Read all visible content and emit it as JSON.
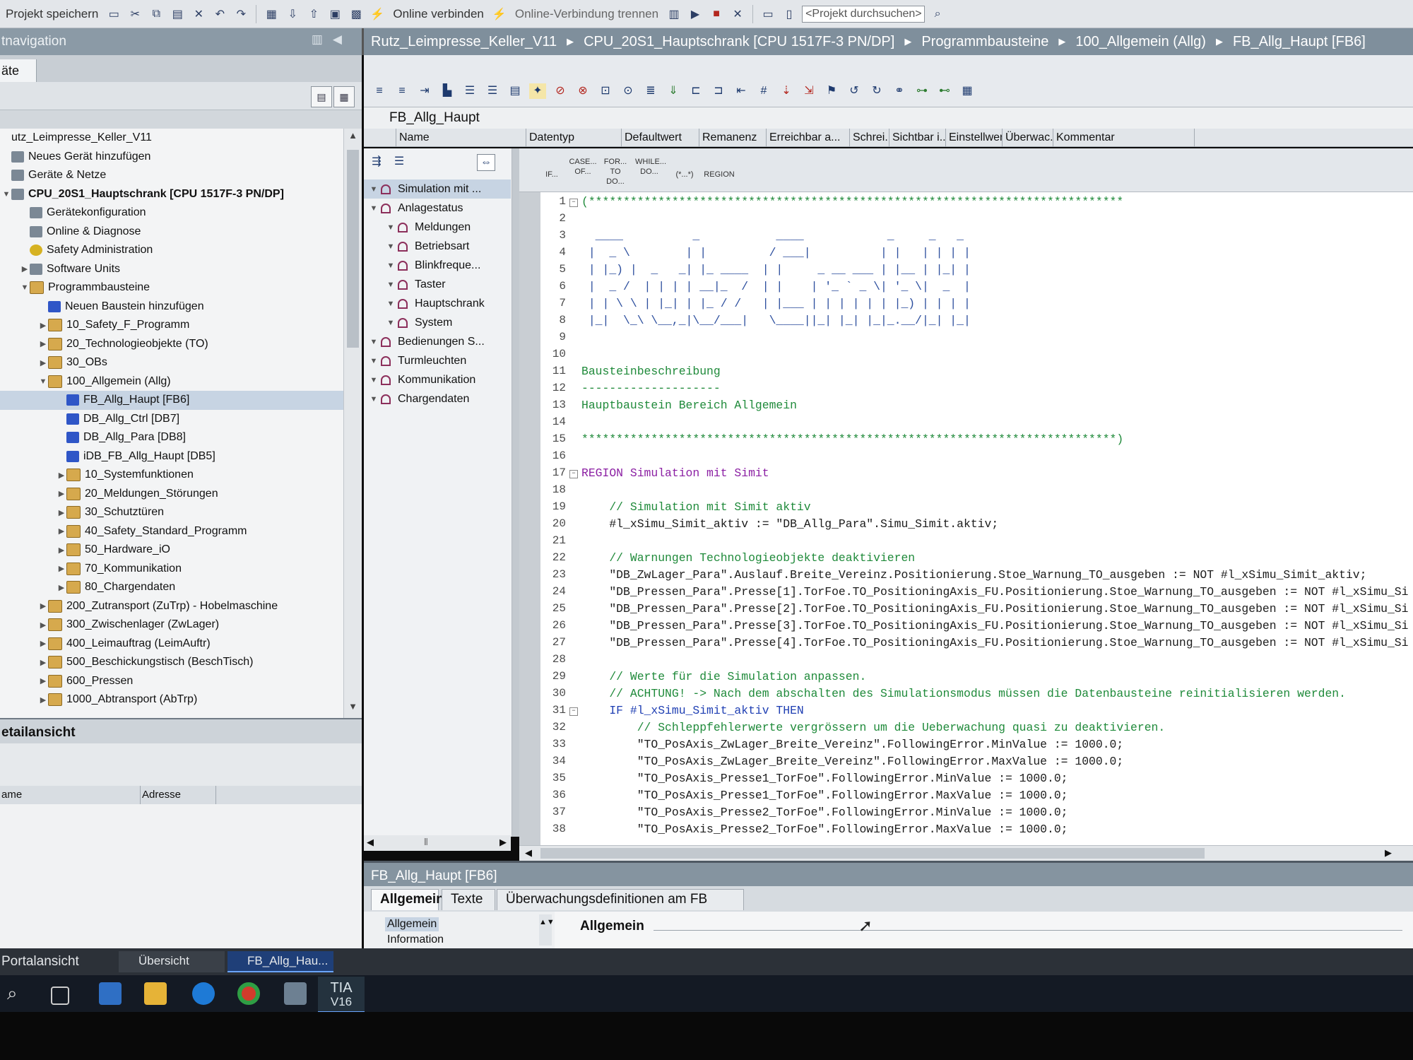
{
  "toolbar": {
    "save_label": "Projekt speichern",
    "connect_label": "Online verbinden",
    "disconnect_label": "Online-Verbindung trennen",
    "search_value": "<Projekt durchsuchen>"
  },
  "nav": {
    "title": "tnavigation",
    "tab": "äte",
    "tree": [
      {
        "label": "utz_Leimpresse_Keller_V11",
        "indent": 0,
        "icon": "none",
        "arrow": ""
      },
      {
        "label": "Neues Gerät hinzufügen",
        "indent": 0,
        "icon": "dev",
        "arrow": ""
      },
      {
        "label": "Geräte & Netze",
        "indent": 0,
        "icon": "dev",
        "arrow": ""
      },
      {
        "label": "CPU_20S1_Hauptschrank [CPU 1517F-3 PN/DP]",
        "indent": 0,
        "icon": "dev",
        "arrow": "▼",
        "bold": true
      },
      {
        "label": "Gerätekonfiguration",
        "indent": 1,
        "icon": "dev",
        "arrow": ""
      },
      {
        "label": "Online & Diagnose",
        "indent": 1,
        "icon": "dev",
        "arrow": ""
      },
      {
        "label": "Safety Administration",
        "indent": 1,
        "icon": "safety",
        "arrow": ""
      },
      {
        "label": "Software Units",
        "indent": 1,
        "icon": "dev",
        "arrow": "▶"
      },
      {
        "label": "Programmbausteine",
        "indent": 1,
        "icon": "folder",
        "arrow": "▼"
      },
      {
        "label": "Neuen Baustein hinzufügen",
        "indent": 2,
        "icon": "blue",
        "arrow": ""
      },
      {
        "label": "10_Safety_F_Programm",
        "indent": 2,
        "icon": "folder",
        "arrow": "▶"
      },
      {
        "label": "20_Technologieobjekte (TO)",
        "indent": 2,
        "icon": "folder",
        "arrow": "▶"
      },
      {
        "label": "30_OBs",
        "indent": 2,
        "icon": "folder",
        "arrow": "▶"
      },
      {
        "label": "100_Allgemein (Allg)",
        "indent": 2,
        "icon": "folder",
        "arrow": "▼"
      },
      {
        "label": "FB_Allg_Haupt [FB6]",
        "indent": 3,
        "icon": "blue",
        "arrow": "",
        "selected": true
      },
      {
        "label": "DB_Allg_Ctrl [DB7]",
        "indent": 3,
        "icon": "blue",
        "arrow": ""
      },
      {
        "label": "DB_Allg_Para [DB8]",
        "indent": 3,
        "icon": "blue",
        "arrow": ""
      },
      {
        "label": "iDB_FB_Allg_Haupt [DB5]",
        "indent": 3,
        "icon": "blue",
        "arrow": ""
      },
      {
        "label": "10_Systemfunktionen",
        "indent": 3,
        "icon": "folder",
        "arrow": "▶"
      },
      {
        "label": "20_Meldungen_Störungen",
        "indent": 3,
        "icon": "folder",
        "arrow": "▶"
      },
      {
        "label": "30_Schutztüren",
        "indent": 3,
        "icon": "folder",
        "arrow": "▶"
      },
      {
        "label": "40_Safety_Standard_Programm",
        "indent": 3,
        "icon": "folder",
        "arrow": "▶"
      },
      {
        "label": "50_Hardware_iO",
        "indent": 3,
        "icon": "folder",
        "arrow": "▶"
      },
      {
        "label": "70_Kommunikation",
        "indent": 3,
        "icon": "folder",
        "arrow": "▶"
      },
      {
        "label": "80_Chargendaten",
        "indent": 3,
        "icon": "folder",
        "arrow": "▶"
      },
      {
        "label": "200_Zutransport (ZuTrp) - Hobelmaschine",
        "indent": 2,
        "icon": "folder",
        "arrow": "▶"
      },
      {
        "label": "300_Zwischenlager (ZwLager)",
        "indent": 2,
        "icon": "folder",
        "arrow": "▶"
      },
      {
        "label": "400_Leimauftrag (LeimAuftr)",
        "indent": 2,
        "icon": "folder",
        "arrow": "▶"
      },
      {
        "label": "500_Beschickungstisch (BeschTisch)",
        "indent": 2,
        "icon": "folder",
        "arrow": "▶"
      },
      {
        "label": "600_Pressen",
        "indent": 2,
        "icon": "folder",
        "arrow": "▶"
      },
      {
        "label": "1000_Abtransport (AbTrp)",
        "indent": 2,
        "icon": "folder",
        "arrow": "▶"
      }
    ]
  },
  "detail": {
    "title": "etailansicht",
    "col_name": "ame",
    "col_address": "Adresse"
  },
  "portal": {
    "portal_label": "Portalansicht",
    "overview_label": "Übersicht",
    "editor_label": "FB_Allg_Hau..."
  },
  "taskbar": {
    "tia_label": "TIA",
    "tia_version": "V16"
  },
  "breadcrumb": [
    "Rutz_Leimpresse_Keller_V11",
    "CPU_20S1_Hauptschrank [CPU 1517F-3 PN/DP]",
    "Programmbausteine",
    "100_Allgemein (Allg)",
    "FB_Allg_Haupt [FB6]"
  ],
  "editor": {
    "block_name": "FB_Allg_Haupt",
    "interface_columns": [
      "Name",
      "Datentyp",
      "Defaultwert",
      "Remanenz",
      "Erreichbar a...",
      "Schrei...",
      "Sichtbar i...",
      "Einstellwert",
      "Überwac...",
      "Kommentar"
    ],
    "snippets": [
      "IF...",
      "CASE... OF...",
      "FOR... TO DO...",
      "WHILE... DO...",
      "(*...*)",
      "REGION"
    ],
    "structure": [
      {
        "label": "Simulation mit ...",
        "level": 0,
        "selected": true
      },
      {
        "label": "Anlagestatus",
        "level": 0
      },
      {
        "label": "Meldungen",
        "level": 1
      },
      {
        "label": "Betriebsart",
        "level": 1
      },
      {
        "label": "Blinkfreque...",
        "level": 1
      },
      {
        "label": "Taster",
        "level": 1
      },
      {
        "label": "Hauptschrank",
        "level": 1
      },
      {
        "label": "System",
        "level": 1
      },
      {
        "label": "Bedienungen S...",
        "level": 0
      },
      {
        "label": "Turmleuchten",
        "level": 0
      },
      {
        "label": "Kommunikation",
        "level": 0
      },
      {
        "label": "Chargendaten",
        "level": 0
      }
    ],
    "code_lines": [
      {
        "n": "1",
        "t": "(*****************************************************************************",
        "c": "cm",
        "fold": "-"
      },
      {
        "n": "2",
        "t": "",
        "c": ""
      },
      {
        "n": "3",
        "t": "  ____          _           ____            _     _   _",
        "c": "art"
      },
      {
        "n": "4",
        "t": " |  _ \\        | |         / ___|          | |   | | | |",
        "c": "art"
      },
      {
        "n": "5",
        "t": " | |_) |  _   _| |_ ____  | |     _ __ ___ | |__ | |_| |",
        "c": "art"
      },
      {
        "n": "6",
        "t": " |  _ /  | | | | __|_  /  | |    | '_ ` _ \\| '_ \\|  _  |",
        "c": "art"
      },
      {
        "n": "7",
        "t": " | | \\ \\ | |_| | |_ / /   | |___ | | | | | | |_) | | | |",
        "c": "art"
      },
      {
        "n": "8",
        "t": " |_|  \\_\\ \\__,_|\\__/___|   \\____||_| |_| |_|_.__/|_| |_|",
        "c": "art"
      },
      {
        "n": "9",
        "t": "",
        "c": ""
      },
      {
        "n": "10",
        "t": "",
        "c": ""
      },
      {
        "n": "11",
        "t": "Bausteinbeschreibung",
        "c": "cm"
      },
      {
        "n": "12",
        "t": "--------------------",
        "c": "cm"
      },
      {
        "n": "13",
        "t": "Hauptbaustein Bereich Allgemein",
        "c": "cm"
      },
      {
        "n": "14",
        "t": "",
        "c": ""
      },
      {
        "n": "15",
        "t": "*****************************************************************************)",
        "c": "cm"
      },
      {
        "n": "16",
        "t": "",
        "c": ""
      },
      {
        "n": "17",
        "t": "REGION Simulation mit Simit",
        "c": "kw",
        "fold": "-"
      },
      {
        "n": "18",
        "t": "",
        "c": ""
      },
      {
        "n": "19",
        "t": "    // Simulation mit Simit aktiv",
        "c": "cm"
      },
      {
        "n": "20",
        "t": "    #l_xSimu_Simit_aktiv := \"DB_Allg_Para\".Simu_Simit.aktiv;",
        "c": ""
      },
      {
        "n": "21",
        "t": "",
        "c": ""
      },
      {
        "n": "22",
        "t": "    // Warnungen Technologieobjekte deaktivieren",
        "c": "cm"
      },
      {
        "n": "23",
        "t": "    \"DB_ZwLager_Para\".Auslauf.Breite_Vereinz.Positionierung.Stoe_Warnung_TO_ausgeben := NOT #l_xSimu_Simit_aktiv;",
        "c": ""
      },
      {
        "n": "24",
        "t": "    \"DB_Pressen_Para\".Presse[1].TorFoe.TO_PositioningAxis_FU.Positionierung.Stoe_Warnung_TO_ausgeben := NOT #l_xSimu_Si",
        "c": ""
      },
      {
        "n": "25",
        "t": "    \"DB_Pressen_Para\".Presse[2].TorFoe.TO_PositioningAxis_FU.Positionierung.Stoe_Warnung_TO_ausgeben := NOT #l_xSimu_Si",
        "c": ""
      },
      {
        "n": "26",
        "t": "    \"DB_Pressen_Para\".Presse[3].TorFoe.TO_PositioningAxis_FU.Positionierung.Stoe_Warnung_TO_ausgeben := NOT #l_xSimu_Si",
        "c": ""
      },
      {
        "n": "27",
        "t": "    \"DB_Pressen_Para\".Presse[4].TorFoe.TO_PositioningAxis_FU.Positionierung.Stoe_Warnung_TO_ausgeben := NOT #l_xSimu_Si",
        "c": ""
      },
      {
        "n": "28",
        "t": "",
        "c": ""
      },
      {
        "n": "29",
        "t": "    // Werte für die Simulation anpassen.",
        "c": "cm"
      },
      {
        "n": "30",
        "t": "    // ACHTUNG! -> Nach dem abschalten des Simulationsmodus müssen die Datenbausteine reinitialisieren werden.",
        "c": "cm"
      },
      {
        "n": "31",
        "t": "    IF #l_xSimu_Simit_aktiv THEN",
        "c": "kb",
        "fold": "-"
      },
      {
        "n": "32",
        "t": "        // Schleppfehlerwerte vergrössern um die Ueberwachung quasi zu deaktivieren.",
        "c": "cm"
      },
      {
        "n": "33",
        "t": "        \"TO_PosAxis_ZwLager_Breite_Vereinz\".FollowingError.MinValue := 1000.0;",
        "c": ""
      },
      {
        "n": "34",
        "t": "        \"TO_PosAxis_ZwLager_Breite_Vereinz\".FollowingError.MaxValue := 1000.0;",
        "c": ""
      },
      {
        "n": "35",
        "t": "        \"TO_PosAxis_Presse1_TorFoe\".FollowingError.MinValue := 1000.0;",
        "c": ""
      },
      {
        "n": "36",
        "t": "        \"TO_PosAxis_Presse1_TorFoe\".FollowingError.MaxValue := 1000.0;",
        "c": ""
      },
      {
        "n": "37",
        "t": "        \"TO_PosAxis_Presse2_TorFoe\".FollowingError.MinValue := 1000.0;",
        "c": ""
      },
      {
        "n": "38",
        "t": "        \"TO_PosAxis_Presse2_TorFoe\".FollowingError.MaxValue := 1000.0;",
        "c": ""
      }
    ]
  },
  "properties": {
    "title": "FB_Allg_Haupt [FB6]",
    "tabs": [
      "Allgemein",
      "Texte",
      "Überwachungsdefinitionen am FB"
    ],
    "nav": [
      "Allgemein",
      "Information"
    ],
    "section": "Allgemein"
  }
}
